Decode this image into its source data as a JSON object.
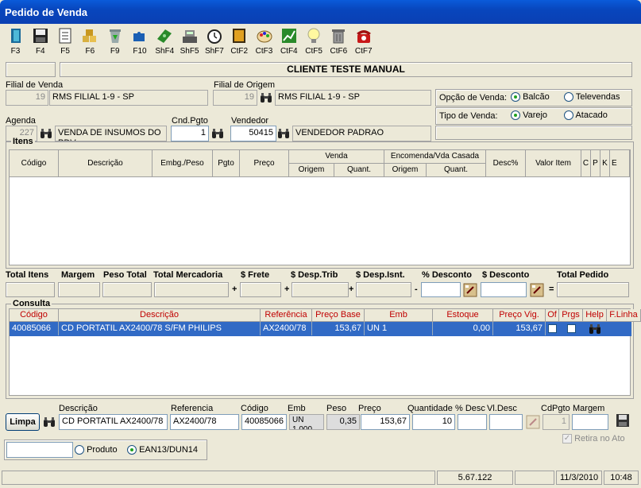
{
  "window": {
    "title": "Pedido de Venda"
  },
  "toolbar": [
    {
      "key": "F3",
      "icon": "exit-door-icon"
    },
    {
      "key": "F4",
      "icon": "save-disk-icon"
    },
    {
      "key": "F5",
      "icon": "document-icon"
    },
    {
      "key": "F6",
      "icon": "boxes-icon"
    },
    {
      "key": "F9",
      "icon": "recycle-bin-icon"
    },
    {
      "key": "F10",
      "icon": "puzzle-icon"
    },
    {
      "key": "ShF4",
      "icon": "money-icon"
    },
    {
      "key": "ShF5",
      "icon": "cash-register-icon"
    },
    {
      "key": "ShF7",
      "icon": "alarm-clock-icon"
    },
    {
      "key": "CtF2",
      "icon": "notepad-icon"
    },
    {
      "key": "CtF3",
      "icon": "palette-icon"
    },
    {
      "key": "CtF4",
      "icon": "chart-icon"
    },
    {
      "key": "CtF5",
      "icon": "lightbulb-icon"
    },
    {
      "key": "CtF6",
      "icon": "trash-can-icon"
    },
    {
      "key": "CtF7",
      "icon": "telephone-icon"
    }
  ],
  "client": {
    "name": "CLIENTE TESTE MANUAL"
  },
  "filial_venda": {
    "label": "Filial de Venda",
    "code": "19",
    "name": "RMS FILIAL 1-9 - SP"
  },
  "filial_origem": {
    "label": "Filial de Origem",
    "code": "19",
    "name": "RMS FILIAL 1-9 - SP"
  },
  "opcao_venda": {
    "label": "Opção de Venda:",
    "options": [
      "Balcão",
      "Televendas"
    ],
    "selected": "Balcão"
  },
  "tipo_venda": {
    "label": "Tipo de Venda:",
    "options": [
      "Varejo",
      "Atacado"
    ],
    "selected": "Varejo"
  },
  "agenda": {
    "label": "Agenda",
    "code": "227",
    "name": "VENDA DE INSUMOS DO PDV"
  },
  "cnd_pgto": {
    "label": "Cnd.Pgto",
    "value": "1"
  },
  "vendedor": {
    "label": "Vendedor",
    "code": "50415",
    "name": "VENDEDOR PADRAO"
  },
  "itens": {
    "title": "Itens",
    "columns": [
      "Código",
      "Descrição",
      "Embg./Peso",
      "Pgto",
      "Preço",
      "Venda",
      "Encomenda/Vda Casada",
      "Desc%",
      "Valor Item",
      "C",
      "P",
      "K",
      "E"
    ],
    "sub_columns": [
      "Origem",
      "Quant.",
      "Origem",
      "Quant."
    ]
  },
  "totals": {
    "labels": [
      "Total Itens",
      "Margem",
      "Peso Total",
      "Total Mercadoria",
      "$ Frete",
      "$ Desp.Trib",
      "$ Desp.Isnt.",
      "% Desconto",
      "$ Desconto",
      "Total Pedido"
    ],
    "ops": [
      "+",
      "+",
      "+",
      "-",
      "="
    ]
  },
  "consulta": {
    "title": "Consulta",
    "columns": [
      "Código",
      "Descrição",
      "Referência",
      "Preço Base",
      "Emb",
      "Estoque",
      "Preço Vig.",
      "Of",
      "Prgs",
      "Help",
      "F.Linha"
    ],
    "rows": [
      {
        "codigo": "40085066",
        "descricao": "CD PORTATIL AX2400/78 S/FM PHILIPS",
        "referencia": "AX2400/78",
        "preco_base": "153,67",
        "emb": "UN 1",
        "estoque": "0,00",
        "preco_vig": "153,67"
      }
    ]
  },
  "entry": {
    "limpa": "Limpa",
    "labels": [
      "Descrição",
      "Referencia",
      "Código",
      "Emb",
      "Peso",
      "Preço",
      "Quantidade",
      "% Desc",
      "Vl.Desc",
      "CdPgto",
      "Margem"
    ],
    "descricao": "CD PORTATIL AX2400/78",
    "referencia": "AX2400/78",
    "codigo": "40085066",
    "emb": "UN 1,000",
    "peso": "0,35",
    "preco": "153,67",
    "quantidade": "10",
    "cdpgto": "1",
    "retira": "Retira no Ato"
  },
  "search_mode": {
    "options": [
      "Produto",
      "EAN13/DUN14"
    ],
    "selected": "EAN13/DUN14"
  },
  "statusbar": {
    "version": "5.67.122",
    "date": "11/3/2010",
    "time": "10:48"
  }
}
